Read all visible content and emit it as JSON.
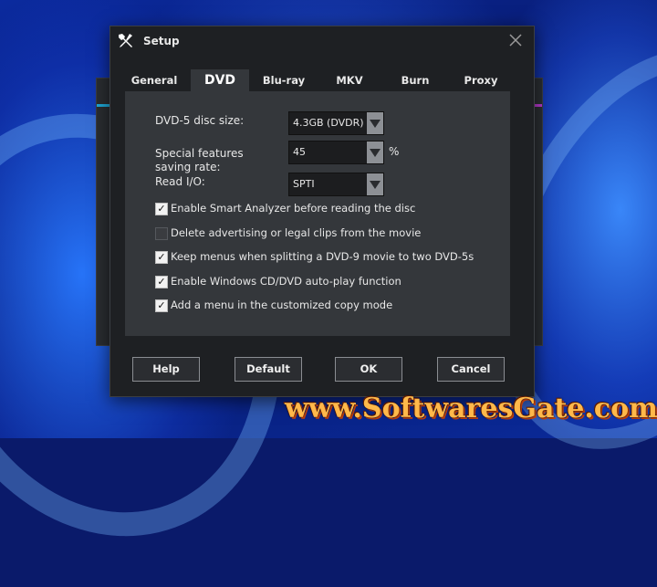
{
  "window": {
    "title": "Setup",
    "app_icon": "tools-icon",
    "close_icon": "close-icon"
  },
  "tabs": [
    {
      "label": "General",
      "active": false
    },
    {
      "label": "DVD",
      "active": true
    },
    {
      "label": "Blu-ray",
      "active": false
    },
    {
      "label": "MKV",
      "active": false
    },
    {
      "label": "Burn",
      "active": false
    },
    {
      "label": "Proxy",
      "active": false
    }
  ],
  "dvd": {
    "disc_size_label": "DVD-5 disc size:",
    "disc_size_value": "4.3GB (DVDR)",
    "special_rate_label": "Special features saving rate:",
    "special_rate_value": "45",
    "special_rate_unit": "%",
    "read_io_label": "Read I/O:",
    "read_io_value": "SPTI"
  },
  "options": [
    {
      "label": "Enable Smart Analyzer before reading the disc",
      "checked": true
    },
    {
      "label": "Delete advertising or legal clips from the movie",
      "checked": false
    },
    {
      "label": "Keep menus when splitting a DVD-9 movie to two DVD-5s",
      "checked": true
    },
    {
      "label": "Enable Windows CD/DVD auto-play function",
      "checked": true
    },
    {
      "label": "Add a menu in the customized copy mode",
      "checked": true
    }
  ],
  "buttons": {
    "help": "Help",
    "default": "Default",
    "ok": "OK",
    "cancel": "Cancel"
  },
  "watermark": "www.SoftwaresGate.com",
  "colors": {
    "dialog_bg": "#1e2023",
    "panel_bg": "#34373b",
    "accent_left": "#1ea7d6",
    "accent_right": "#b338c9",
    "watermark": "#ffb84a"
  }
}
